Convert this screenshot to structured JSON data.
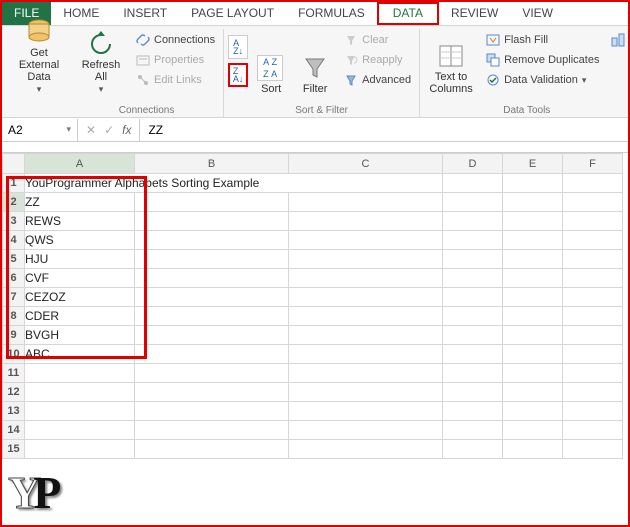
{
  "tabs": {
    "file": "FILE",
    "home": "HOME",
    "insert": "INSERT",
    "pageLayout": "PAGE LAYOUT",
    "formulas": "FORMULAS",
    "data": "DATA",
    "review": "REVIEW",
    "view": "VIEW"
  },
  "ribbon": {
    "getExternal": "Get External\nData",
    "refreshAll": "Refresh\nAll",
    "connections": "Connections",
    "properties": "Properties",
    "editLinks": "Edit Links",
    "connectionsGroup": "Connections",
    "sort": "Sort",
    "filter": "Filter",
    "clear": "Clear",
    "reapply": "Reapply",
    "advanced": "Advanced",
    "sortFilterGroup": "Sort & Filter",
    "textToColumns": "Text to\nColumns",
    "flashFill": "Flash Fill",
    "removeDup": "Remove Duplicates",
    "dataValidation": "Data Validation",
    "dataToolsGroup": "Data Tools"
  },
  "formulaBar": {
    "nameBox": "A2",
    "value": "ZZ"
  },
  "columns": [
    "A",
    "B",
    "C",
    "D",
    "E",
    "F"
  ],
  "rows": [
    "1",
    "2",
    "3",
    "4",
    "5",
    "6",
    "7",
    "8",
    "9",
    "10",
    "11",
    "12",
    "13",
    "14",
    "15"
  ],
  "cells": {
    "A1": "YouProgrammer Alphabets Sorting Example",
    "A2": "ZZ",
    "A3": "REWS",
    "A4": "QWS",
    "A5": "HJU",
    "A6": "CVF",
    "A7": "CEZOZ",
    "A8": "CDER",
    "A9": "BVGH",
    "A10": "ABC"
  },
  "logo": {
    "y": "Y",
    "p": "P"
  }
}
